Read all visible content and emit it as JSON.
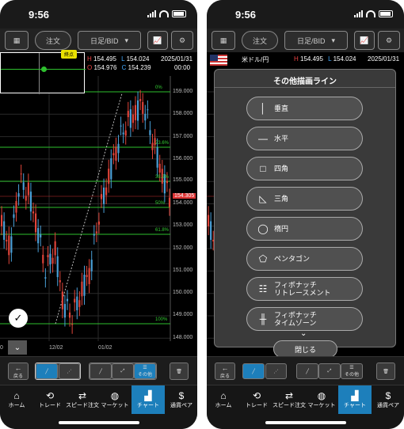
{
  "status": {
    "time": "9:56"
  },
  "toolbar": {
    "order": "注文",
    "timeframe": "日足/BID"
  },
  "rates": {
    "pair": "米ドル/円",
    "h_label": "H",
    "h": "154.495",
    "l_label": "L",
    "l": "154.024",
    "o_label": "O",
    "o": "154.976",
    "c_label": "C",
    "c": "154.239",
    "date": "2025/01/31",
    "time": "00:00"
  },
  "badge": "終点",
  "yaxis": [
    "159.000",
    "158.000",
    "157.000",
    "156.000",
    "155.000",
    "154.305",
    "154.000",
    "153.000",
    "152.000",
    "151.000",
    "150.000",
    "149.000",
    "148.000"
  ],
  "fib": [
    "0%",
    "23.6%",
    "38.2%",
    "50%",
    "61.8%",
    "100%"
  ],
  "xaxis": [
    "12/02",
    "01/02"
  ],
  "xaxis_left": "0",
  "bottom": {
    "back": "戻る",
    "other": "その他"
  },
  "tabs": [
    "ホーム",
    "トレード",
    "スピード注文",
    "マーケット",
    "チャート",
    "通貨ペア"
  ],
  "modal": {
    "title": "その他描画ライン",
    "items": [
      "垂直",
      "水平",
      "四角",
      "三角",
      "楕円",
      "ペンタゴン",
      "フィボナッチ\nリトレースメント",
      "フィボナッチ\nタイムゾーン"
    ],
    "close": "閉じる"
  },
  "colors": {
    "up": "#e0443a",
    "down": "#4aa0d8",
    "fib": "#2ec02e",
    "active": "#1d7fbb"
  },
  "chart_data": {
    "type": "candlestick",
    "pair": "USD/JPY",
    "timeframe": "daily",
    "ylim": [
      148.0,
      159.0
    ],
    "last_price": 154.305
  }
}
